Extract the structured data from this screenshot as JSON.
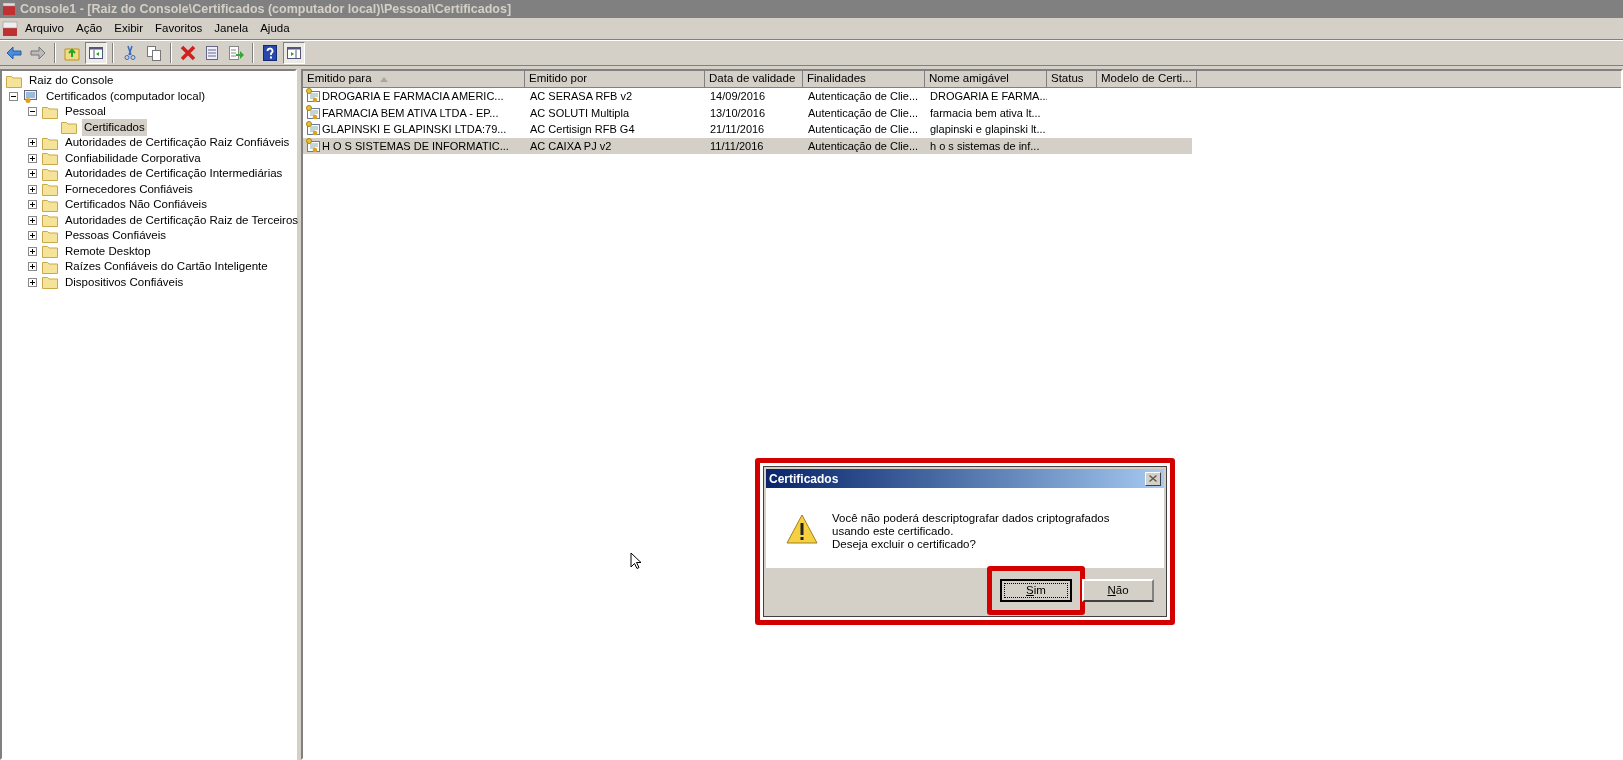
{
  "window": {
    "title": "Console1 - [Raiz do Console\\Certificados (computador local)\\Pessoal\\Certificados]",
    "active": false
  },
  "menu": [
    "Arquivo",
    "Ação",
    "Exibir",
    "Favoritos",
    "Janela",
    "Ajuda"
  ],
  "toolbar": [
    {
      "kind": "back",
      "pressed": false
    },
    {
      "kind": "forward",
      "pressed": false
    },
    {
      "kind": "sep"
    },
    {
      "kind": "up",
      "pressed": false
    },
    {
      "kind": "tree",
      "pressed": true
    },
    {
      "kind": "sep"
    },
    {
      "kind": "cut",
      "pressed": false
    },
    {
      "kind": "copy",
      "pressed": false
    },
    {
      "kind": "sep"
    },
    {
      "kind": "delete",
      "pressed": false
    },
    {
      "kind": "properties",
      "pressed": false
    },
    {
      "kind": "export",
      "pressed": false
    },
    {
      "kind": "sep"
    },
    {
      "kind": "help",
      "pressed": false
    },
    {
      "kind": "actions",
      "pressed": true
    }
  ],
  "tree": [
    {
      "label": "Raiz do Console",
      "kind": "folder",
      "selected": false,
      "children": [
        {
          "label": "Certificados (computador local)",
          "kind": "store",
          "selected": false,
          "expanded": true,
          "children": [
            {
              "label": "Pessoal",
              "kind": "folder",
              "selected": false,
              "expanded": true,
              "children": [
                {
                  "label": "Certificados",
                  "kind": "folder",
                  "selected": true
                }
              ]
            },
            {
              "label": "Autoridades de Certificação Raiz Confiáveis",
              "kind": "folder",
              "selected": false,
              "expanded": false
            },
            {
              "label": "Confiabilidade Corporativa",
              "kind": "folder",
              "selected": false,
              "expanded": false
            },
            {
              "label": "Autoridades de Certificação Intermediárias",
              "kind": "folder",
              "selected": false,
              "expanded": false
            },
            {
              "label": "Fornecedores Confiáveis",
              "kind": "folder",
              "selected": false,
              "expanded": false
            },
            {
              "label": "Certificados Não Confiáveis",
              "kind": "folder",
              "selected": false,
              "expanded": false
            },
            {
              "label": "Autoridades de Certificação Raiz de Terceiros",
              "kind": "folder",
              "selected": false,
              "expanded": false
            },
            {
              "label": "Pessoas Confiáveis",
              "kind": "folder",
              "selected": false,
              "expanded": false
            },
            {
              "label": "Remote Desktop",
              "kind": "folder",
              "selected": false,
              "expanded": false
            },
            {
              "label": "Raízes Confiáveis do Cartão Inteligente",
              "kind": "folder",
              "selected": false,
              "expanded": false
            },
            {
              "label": "Dispositivos Confiáveis",
              "kind": "folder",
              "selected": false,
              "expanded": false
            }
          ]
        }
      ]
    }
  ],
  "table": {
    "columns": [
      {
        "label": "Emitido para",
        "sorted": true
      },
      {
        "label": "Emitido por",
        "sorted": false
      },
      {
        "label": "Data de validade",
        "sorted": false
      },
      {
        "label": "Finalidades",
        "sorted": false
      },
      {
        "label": "Nome amigável",
        "sorted": false
      },
      {
        "label": "Status",
        "sorted": false
      },
      {
        "label": "Modelo de Certi...",
        "sorted": false
      }
    ],
    "rows": [
      {
        "selected": false,
        "cells": [
          "DROGARIA E FARMACIA AMERIC...",
          "AC SERASA RFB v2",
          "14/09/2016",
          "Autenticação de Clie...",
          "DROGARIA E FARMA..."
        ]
      },
      {
        "selected": false,
        "cells": [
          "FARMACIA BEM ATIVA LTDA - EP...",
          "AC SOLUTI Multipla",
          "13/10/2016",
          "Autenticação de Clie...",
          "farmacia bem ativa lt..."
        ]
      },
      {
        "selected": false,
        "cells": [
          "GLAPINSKI E GLAPINSKI LTDA:79...",
          "AC Certisign RFB G4",
          "21/11/2016",
          "Autenticação de Clie...",
          "glapinski e glapinski lt..."
        ]
      },
      {
        "selected": true,
        "cells": [
          "H O S SISTEMAS DE INFORMATIC...",
          "AC CAIXA PJ v2",
          "11/11/2016",
          "Autenticação de Clie...",
          "h o s sistemas de inf..."
        ]
      }
    ]
  },
  "dialog": {
    "title": "Certificados",
    "highlighted": true,
    "messages": [
      "Você não poderá descriptografar dados criptografados usando este certificado.",
      "Deseja excluir o certificado?"
    ],
    "buttons": [
      {
        "label": "Sim",
        "default": true,
        "highlighted": true
      },
      {
        "label": "Não",
        "default": false,
        "highlighted": false
      }
    ]
  }
}
